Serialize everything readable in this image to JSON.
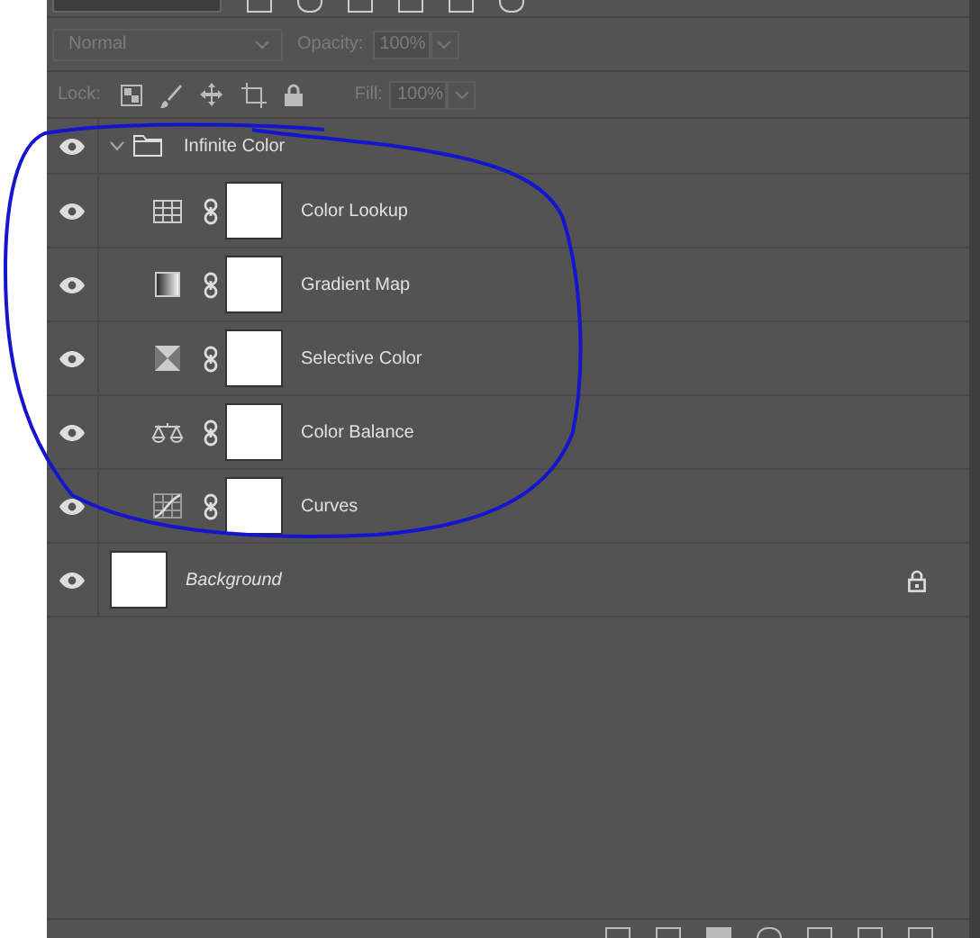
{
  "blend_mode": {
    "value": "Normal",
    "disabled": true
  },
  "opacity": {
    "label": "Opacity:",
    "value": "100%",
    "disabled": true
  },
  "lock": {
    "label": "Lock:"
  },
  "fill": {
    "label": "Fill:",
    "value": "100%",
    "disabled": true
  },
  "layers": [
    {
      "name": "Infinite Color",
      "kind": "group",
      "expanded": true,
      "visible": true,
      "children": [
        {
          "name": "Color Lookup",
          "kind": "color-lookup",
          "visible": true
        },
        {
          "name": "Gradient Map",
          "kind": "gradient-map",
          "visible": true
        },
        {
          "name": "Selective Color",
          "kind": "selective-color",
          "visible": true
        },
        {
          "name": "Color Balance",
          "kind": "color-balance",
          "visible": true
        },
        {
          "name": "Curves",
          "kind": "curves",
          "visible": true
        }
      ]
    },
    {
      "name": "Background",
      "kind": "background",
      "visible": true,
      "locked": true
    }
  ]
}
